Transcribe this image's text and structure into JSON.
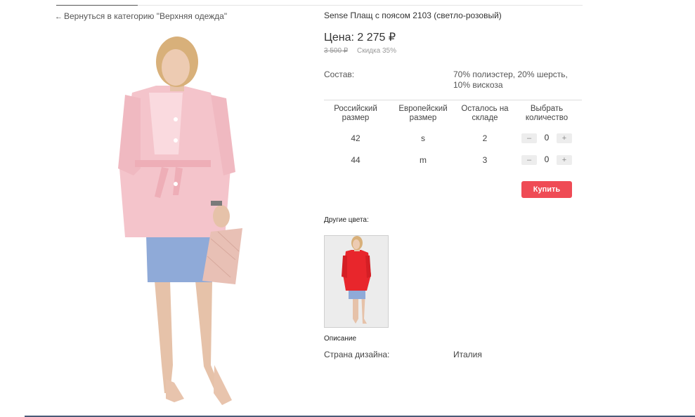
{
  "nav": {
    "back_arrow": "←",
    "back_link": "Вернуться в категорию \"Верхняя одежда\""
  },
  "product": {
    "title": "Sense Плащ с поясом 2103 (светло-розовый)",
    "price": "Цена: 2 275 ₽",
    "old_price": "3 500 ₽",
    "discount": "Скидка 35%",
    "composition_label": "Состав:",
    "composition_value": "70% полиэстер, 20% шерсть, 10% вискоза"
  },
  "size_table": {
    "headers": [
      "Российский размер",
      "Европейский размер",
      "Осталось на складе",
      "Выбрать количество"
    ],
    "rows": [
      {
        "ru": "42",
        "eu": "s",
        "stock": "2",
        "qty": "0"
      },
      {
        "ru": "44",
        "eu": "m",
        "stock": "3",
        "qty": "0"
      }
    ],
    "minus": "–",
    "plus": "+"
  },
  "buy_button": "Купить",
  "other_colors_label": "Другие цвета:",
  "description": {
    "title": "Описание",
    "country_label": "Страна дизайна:",
    "country_value": "Италия"
  },
  "colors": {
    "accent": "#ef4b55",
    "coat_pink": "#f4c4cb",
    "skirt_blue": "#8faad8",
    "thumb_coat_red": "#e8262c"
  }
}
